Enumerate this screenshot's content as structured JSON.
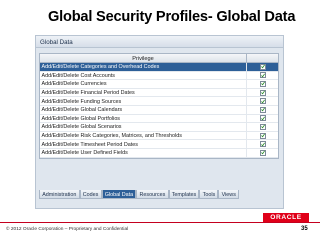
{
  "slide": {
    "title": "Global Security Profiles- Global Data",
    "copyright": "© 2012 Oracle Corporation – Proprietary and Confidential",
    "page_number": "35",
    "logo_text": "ORACLE"
  },
  "panel": {
    "header": "Global Data",
    "column_header": "Privilege",
    "rows": [
      {
        "label": "Add/Edit/Delete Categories and Overhead Codes",
        "checked": true,
        "selected": true
      },
      {
        "label": "Add/Edit/Delete Cost Accounts",
        "checked": true,
        "selected": false
      },
      {
        "label": "Add/Edit/Delete Currencies",
        "checked": true,
        "selected": false
      },
      {
        "label": "Add/Edit/Delete Financial Period Dates",
        "checked": true,
        "selected": false
      },
      {
        "label": "Add/Edit/Delete Funding Sources",
        "checked": true,
        "selected": false
      },
      {
        "label": "Add/Edit/Delete Global Calendars",
        "checked": true,
        "selected": false
      },
      {
        "label": "Add/Edit/Delete Global Portfolios",
        "checked": true,
        "selected": false
      },
      {
        "label": "Add/Edit/Delete Global Scenarios",
        "checked": true,
        "selected": false
      },
      {
        "label": "Add/Edit/Delete Risk Categories, Matrices, and Thresholds",
        "checked": true,
        "selected": false
      },
      {
        "label": "Add/Edit/Delete Timesheet Period Dates",
        "checked": true,
        "selected": false
      },
      {
        "label": "Add/Edit/Delete User Defined Fields",
        "checked": true,
        "selected": false
      }
    ],
    "tabs": [
      {
        "label": "Administration",
        "active": false
      },
      {
        "label": "Codes",
        "active": false
      },
      {
        "label": "Global Data",
        "active": true
      },
      {
        "label": "Resources",
        "active": false
      },
      {
        "label": "Templates",
        "active": false
      },
      {
        "label": "Tools",
        "active": false
      },
      {
        "label": "Views",
        "active": false
      }
    ]
  },
  "colors": {
    "selected_row": "#2d5f98",
    "check": "#2a8a2a",
    "brand_red": "#e00019"
  }
}
